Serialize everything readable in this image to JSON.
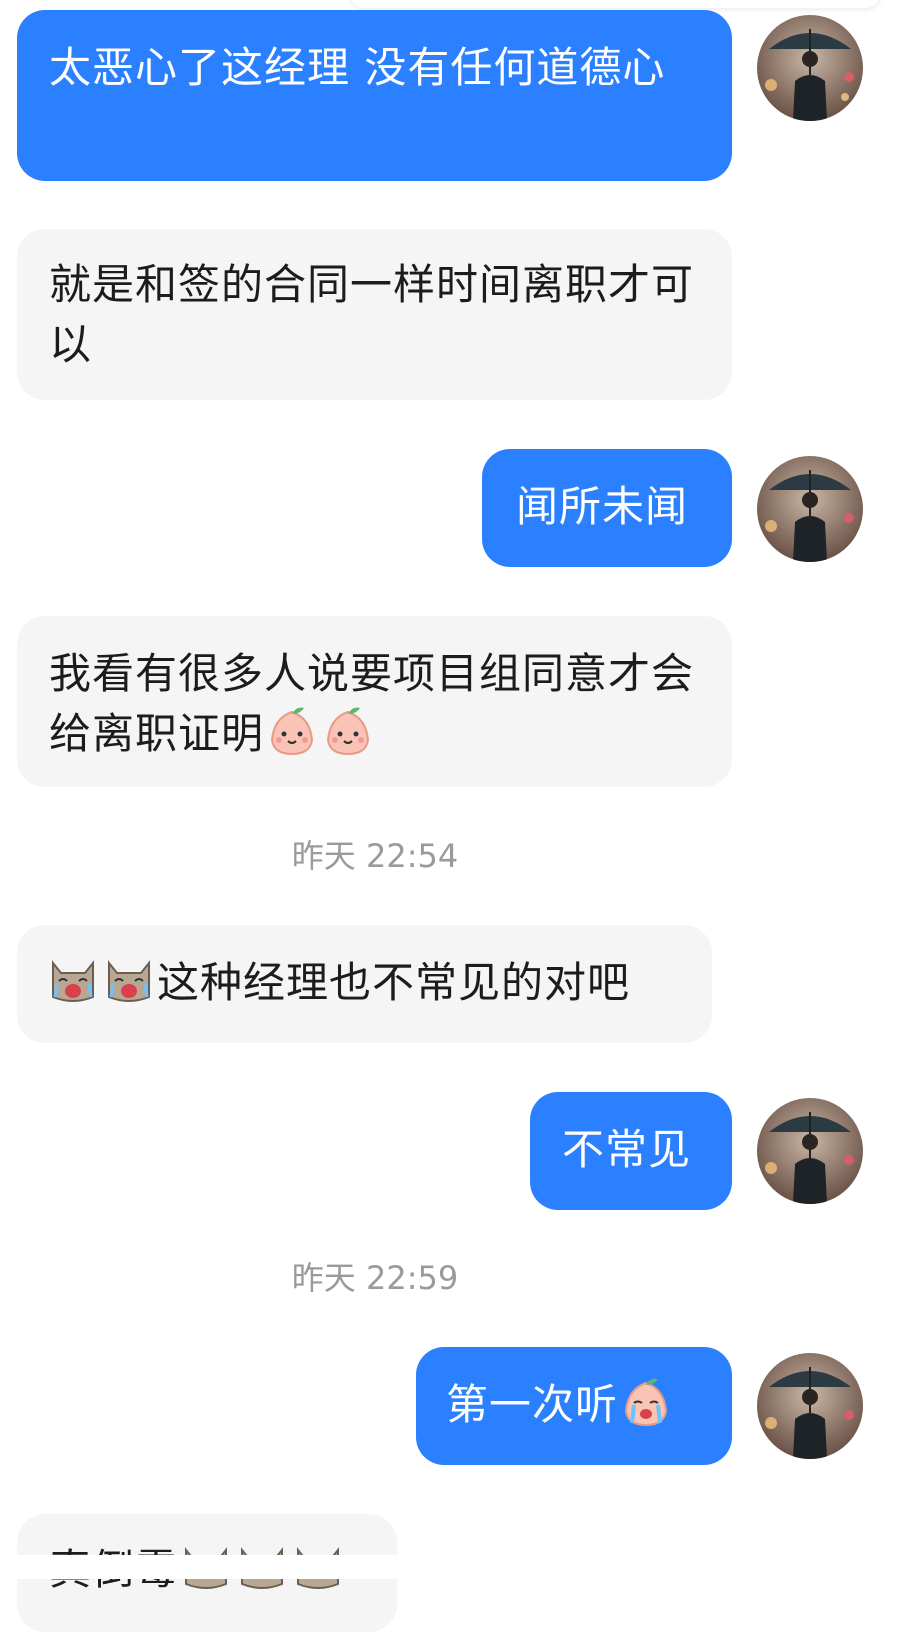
{
  "colors": {
    "outgoing_bubble": "#2b80ff",
    "incoming_bubble": "#f5f5f5",
    "timestamp_text": "#9a9a9a"
  },
  "messages": [
    {
      "direction": "outgoing",
      "text": "太恶心了这经理 没有任何道德心"
    },
    {
      "direction": "incoming",
      "text": "就是和签的合同一样时间离职才可以"
    },
    {
      "direction": "outgoing",
      "text": "闻所未闻"
    },
    {
      "direction": "incoming",
      "text": "我看有很多人说要项目组同意才会给离职证明",
      "emojis": [
        "peach-face-emoji",
        "peach-face-emoji"
      ]
    },
    {
      "timestamp": "昨天 22:54"
    },
    {
      "direction": "incoming",
      "text": "这种经理也不常见的对吧",
      "leading_emojis": [
        "crying-cat-emoji",
        "crying-cat-emoji"
      ]
    },
    {
      "direction": "outgoing",
      "text": "不常见"
    },
    {
      "timestamp": "昨天 22:59"
    },
    {
      "direction": "outgoing",
      "text": "第一次听",
      "emojis": [
        "crying-peach-emoji"
      ]
    },
    {
      "direction": "incoming",
      "text": "真倒霉",
      "emojis": [
        "crying-cat-emoji",
        "crying-cat-emoji",
        "crying-cat-emoji"
      ],
      "partially_visible": true
    }
  ],
  "avatar": {
    "icon": "umbrella-man-avatar"
  }
}
